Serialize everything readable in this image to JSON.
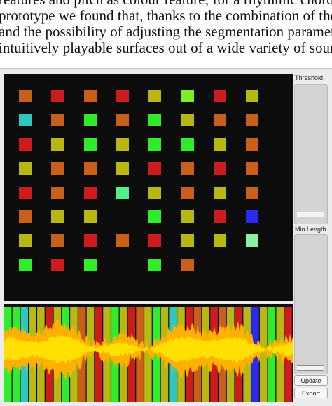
{
  "paper": {
    "lines": [
      "features and pitch as colour feature; for a rhythmic chord pr",
      "prototype we found that, thanks to the combination of the gr",
      "and the possibility of adjusting the segmentation parameters",
      "intuitively playable surfaces out of a wide variety of sound"
    ]
  },
  "controls": {
    "threshold_label": "Threshold",
    "threshold_value": 0.95,
    "min_length_label": "Min Length",
    "min_length_value": 0.98,
    "update_label": "Update",
    "export_label": "Export"
  },
  "grid": {
    "rows": [
      [
        "#c8601a",
        "#cc1c1c",
        "#c8601a",
        "#cc1c1c",
        "#b8b814",
        "#7ced2a",
        "#cc1c1c",
        "#b8b814"
      ],
      [
        "#2fc7c0",
        "#c8601a",
        "#2fed2a",
        "#c8601a",
        "#2fed2a",
        "#b8b814",
        "#c8601a",
        "#c8601a"
      ],
      [
        "#cc1c1c",
        "#b8b814",
        "#2fed2a",
        "#b8b814",
        "#2fed2a",
        "#2fed2a",
        "#b8b814",
        "#c8601a"
      ],
      [
        "#b8b814",
        "#c8601a",
        "#c8601a",
        "#b8b814",
        "#cc1c1c",
        "#c8601a",
        "#cc1c1c",
        "#c8601a"
      ],
      [
        "#cc1c1c",
        "#c8601a",
        "#cc1c1c",
        "#4ff08a",
        "#b8b814",
        "#c8601a",
        "#b8b814",
        "#c8601a"
      ],
      [
        "#c8601a",
        "#b8b814",
        "#b8b814",
        "",
        "#2fed2a",
        "#b8b814",
        "#cc1c1c",
        "#2a2af0"
      ],
      [
        "#b8b814",
        "#c8601a",
        "#cc1c1c",
        "#c8601a",
        "#cc1c1c",
        "#b8b814",
        "#b8b814",
        "#8cf0a0"
      ],
      [
        "#2fed2a",
        "#cc1c1c",
        "#2fed2a",
        "",
        "#2fed2a",
        "#c8601a",
        "",
        ""
      ]
    ]
  },
  "waveform": {
    "colors": {
      "red": "#cc1c1c",
      "orange": "#c8601a",
      "olive": "#b8b814",
      "green": "#2fed2a",
      "cyan": "#2fc7c0",
      "blue": "#2a2af0",
      "wave_outer": "#ffb000",
      "wave_inner": "#ffe000"
    },
    "segments": [
      "green",
      "green",
      "cyan",
      "olive",
      "olive",
      "red",
      "olive",
      "green",
      "olive",
      "orange",
      "olive",
      "red",
      "olive",
      "green",
      "olive",
      "red",
      "orange",
      "olive",
      "green",
      "olive",
      "cyan",
      "olive",
      "red",
      "orange",
      "olive",
      "red",
      "orange",
      "olive",
      "red",
      "olive",
      "blue",
      "olive",
      "green",
      "olive",
      "red"
    ]
  }
}
